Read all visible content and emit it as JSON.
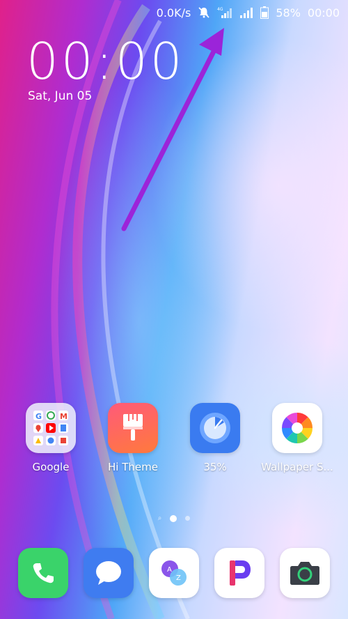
{
  "status_bar": {
    "net_speed": "0.0K/s",
    "battery": "58%",
    "time": "00:00",
    "icons": [
      "mute-bell-icon",
      "signal-4g-icon",
      "signal-icon",
      "battery-icon"
    ]
  },
  "clock": {
    "time": "00:00",
    "date": "Sat, Jun 05"
  },
  "apps": [
    {
      "label": "Google",
      "icon": "google-folder-icon"
    },
    {
      "label": "Hi Theme",
      "icon": "paint-brush-icon"
    },
    {
      "label": "35%",
      "icon": "speed-gauge-icon"
    },
    {
      "label": "Wallpaper S...",
      "icon": "color-wheel-icon"
    }
  ],
  "dock": [
    {
      "icon": "phone-icon"
    },
    {
      "icon": "messages-icon"
    },
    {
      "icon": "translate-az-icon"
    },
    {
      "icon": "p-app-icon"
    },
    {
      "icon": "camera-icon"
    }
  ],
  "page_indicator": {
    "pages": 2,
    "current": 1
  },
  "colors": {
    "arrow": "#9b24d9",
    "phone_green": "#3ad36a",
    "messages_blue": "#3f7cf0"
  }
}
